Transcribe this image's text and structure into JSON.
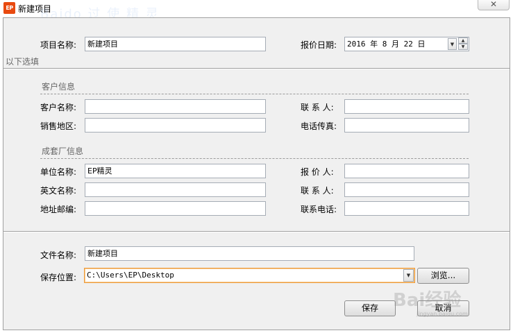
{
  "window": {
    "title": "新建项目",
    "app_icon_text": "EP",
    "close_glyph": "✕"
  },
  "project": {
    "name_label": "项目名称:",
    "name_value": "新建项目",
    "date_label": "报价日期:",
    "date_value": "2016 年 8 月 22 日"
  },
  "optional_label": "以下选填",
  "customer": {
    "section_title": "客户信息",
    "name_label": "客户名称:",
    "name_value": "",
    "contact_label": "联 系 人:",
    "contact_value": "",
    "region_label": "销售地区:",
    "region_value": "",
    "phone_fax_label": "电话传真:",
    "phone_fax_value": ""
  },
  "manufacturer": {
    "section_title": "成套厂信息",
    "company_label": "单位名称:",
    "company_value": "EP精灵",
    "quoter_label": "报 价 人:",
    "quoter_value": "",
    "english_name_label": "英文名称:",
    "english_name_value": "",
    "contact_label": "联 系 人:",
    "contact_value": "",
    "address_label": "地址邮编:",
    "address_value": "",
    "phone_label": "联系电话:",
    "phone_value": ""
  },
  "file": {
    "name_label": "文件名称:",
    "name_value": "新建项目",
    "location_label": "保存位置:",
    "location_value": "C:\\Users\\EP\\Desktop",
    "browse_label": "浏览..."
  },
  "actions": {
    "save_label": "保存",
    "cancel_label": "取消"
  }
}
